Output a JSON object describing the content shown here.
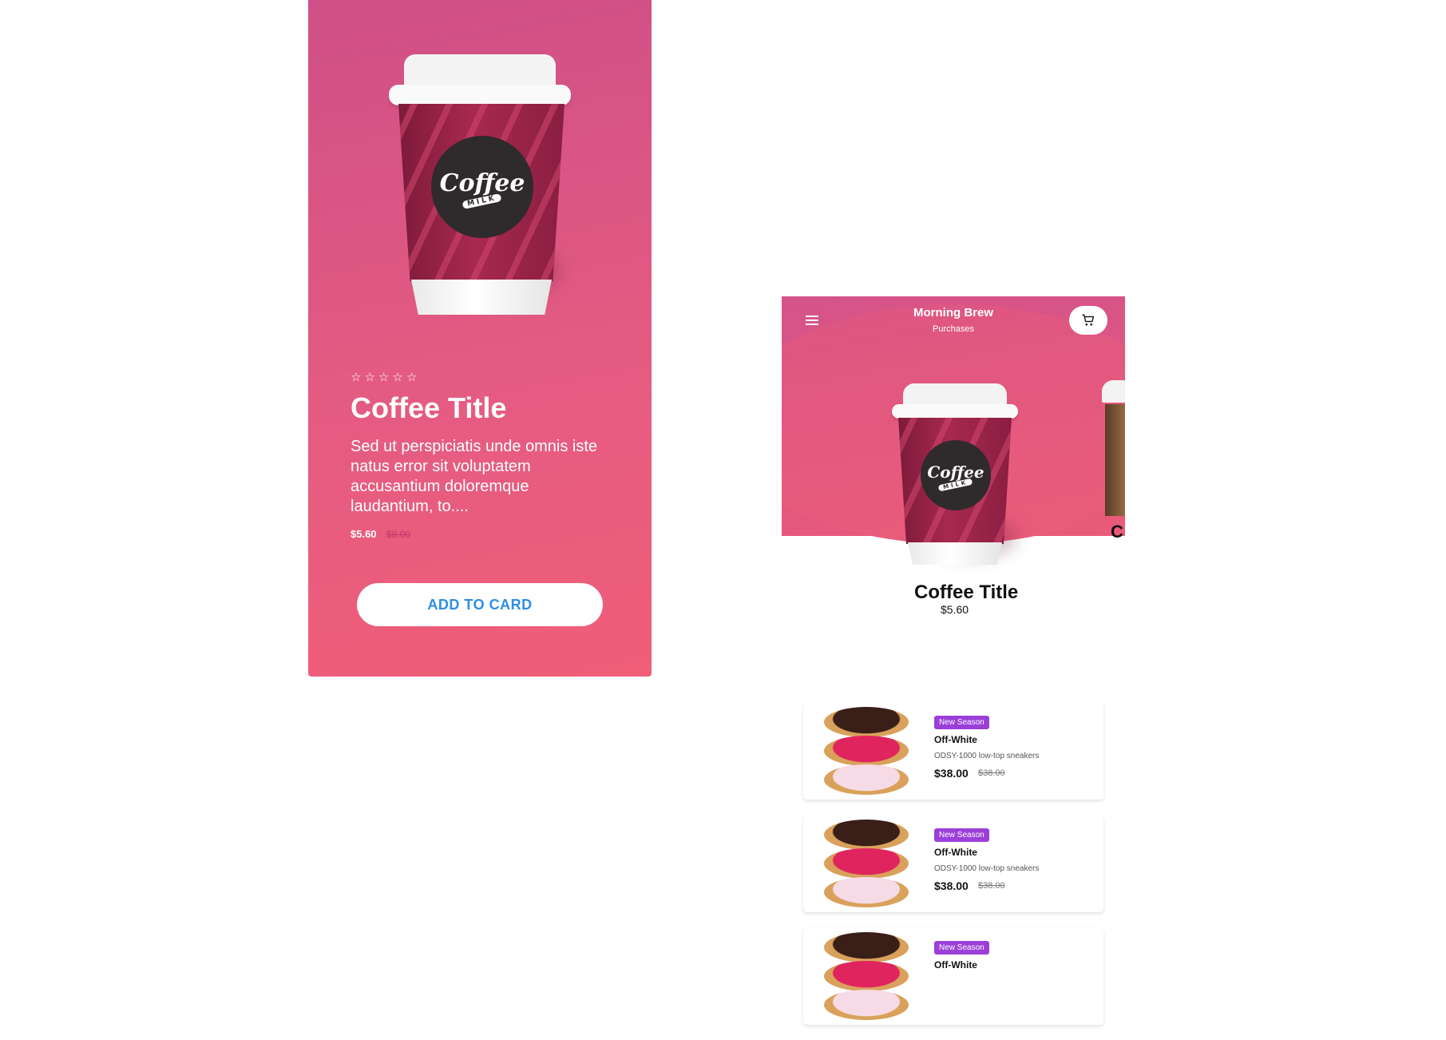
{
  "detail": {
    "rating_stars": [
      "☆",
      "☆",
      "☆",
      "☆",
      "☆"
    ],
    "cup_logo": "Coffee",
    "cup_logo_sub": "MILK",
    "title": "Coffee Title",
    "description": "Sed ut perspiciatis unde omnis iste natus error sit voluptatem accusantium doloremque laudantium, to....",
    "price": "$5.60",
    "old_price": "$8.00",
    "button_label": "ADD TO CARD"
  },
  "header": {
    "title": "Morning Brew",
    "subtitle": "Purchases",
    "menu_icon": "hamburger-menu-icon",
    "cart_icon": "shopping-cart-icon"
  },
  "carousel": {
    "title": "Coffee Title",
    "price": "$5.60",
    "next_item_partial_title": "C"
  },
  "products": [
    {
      "badge": "New Season",
      "brand": "Off-White",
      "description": "ODSY-1000 low-top sneakers",
      "price": "$38.00",
      "old_price": "$38.00"
    },
    {
      "badge": "New Season",
      "brand": "Off-White",
      "description": "ODSY-1000 low-top sneakers",
      "price": "$38.00",
      "old_price": "$38.00"
    },
    {
      "badge": "New Season",
      "brand": "Off-White",
      "description": "",
      "price": "",
      "old_price": ""
    }
  ],
  "colors": {
    "primary_gradient_start": "#cf4f86",
    "primary_gradient_end": "#f05e78",
    "button_text": "#2d8ee6",
    "badge": "#9b3fd9"
  }
}
